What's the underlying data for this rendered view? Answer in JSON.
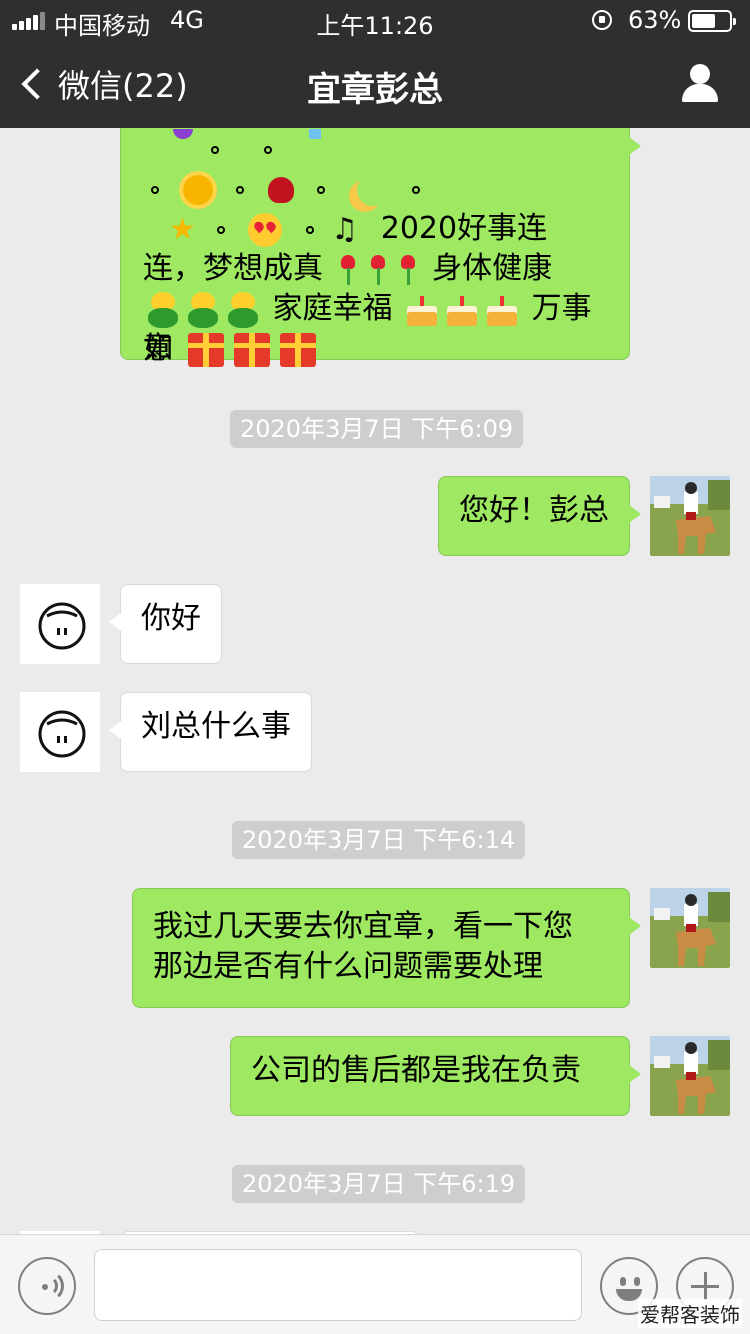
{
  "status_bar": {
    "carrier": "中国移动",
    "network": "4G",
    "time": "上午11:26",
    "battery_percent": "63%",
    "battery_level": 0.63
  },
  "nav": {
    "back_label": "微信(22)",
    "title": "宜章彭总"
  },
  "chat": {
    "first_message": {
      "line1": "2020好事连",
      "line2": "连，梦想成真",
      "line2b": "身体健康",
      "line3": "家庭幸福",
      "line3b": "万事如",
      "line4": "意"
    },
    "timestamps": [
      "2020年3月7日 下午6:09",
      "2020年3月7日 下午6:14",
      "2020年3月7日 下午6:19"
    ],
    "messages": [
      {
        "from": "me",
        "text": "您好！彭总"
      },
      {
        "from": "other",
        "text": "你好"
      },
      {
        "from": "other",
        "text": "刘总什么事"
      },
      {
        "from": "me",
        "text_line1": "我过几天要去你宜章，看一下您",
        "text_line2": "那边是否有什么问题需要处理"
      },
      {
        "from": "me",
        "text": "公司的售后都是我在负责"
      }
    ]
  },
  "input_bar": {
    "value": "",
    "icons": [
      "voice-icon",
      "emoji-icon",
      "plus-icon"
    ]
  },
  "watermark": "爱帮客装饰",
  "colors": {
    "header_bg": "#2f2f31",
    "chat_bg": "#ebebeb",
    "outgoing_bubble": "#9ee862",
    "incoming_bubble": "#ffffff",
    "timestamp_bg": "#cecece"
  }
}
